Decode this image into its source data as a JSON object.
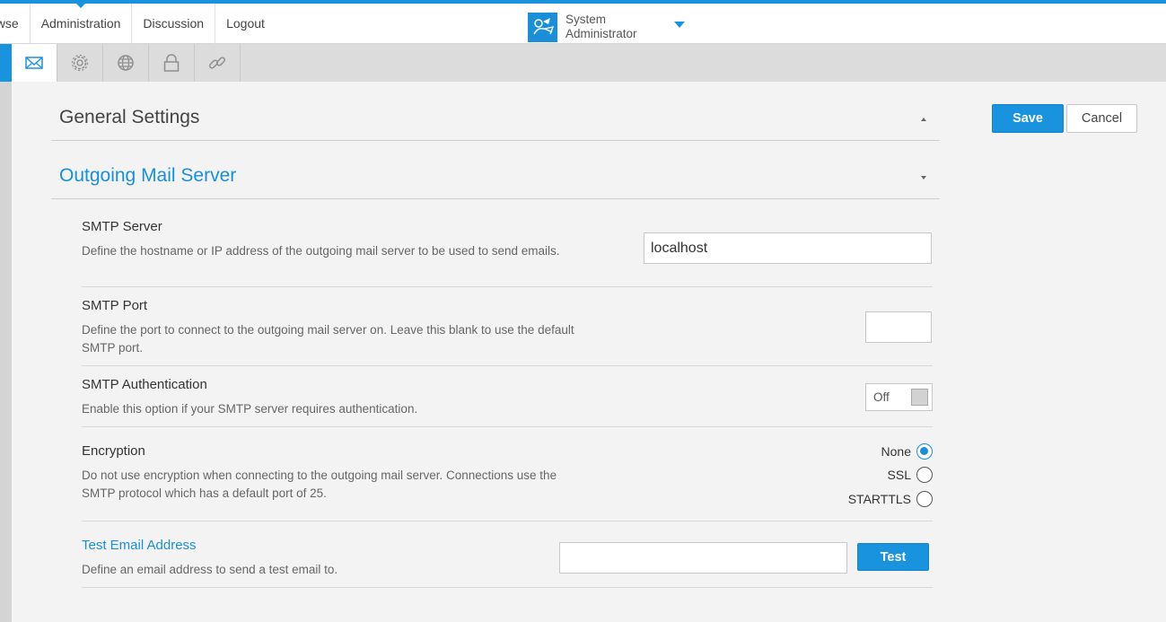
{
  "nav": {
    "items": [
      {
        "label": "owse"
      },
      {
        "label": "Administration"
      },
      {
        "label": "Discussion"
      },
      {
        "label": "Logout"
      }
    ]
  },
  "user": {
    "name_line1": "System",
    "name_line2": "Administrator"
  },
  "tabs": [
    {
      "icon": "envelope-icon"
    },
    {
      "icon": "gear-icon"
    },
    {
      "icon": "globe-icon"
    },
    {
      "icon": "lock-icon"
    },
    {
      "icon": "link-icon"
    }
  ],
  "sections": {
    "general": {
      "title": "General Settings"
    },
    "outgoing": {
      "title": "Outgoing Mail Server"
    }
  },
  "settings": {
    "smtp_server": {
      "label": "SMTP Server",
      "description": "Define the hostname or IP address of the outgoing mail server to be used to send emails.",
      "value": "localhost"
    },
    "smtp_port": {
      "label": "SMTP Port",
      "description": "Define the port to connect to the outgoing mail server on. Leave this blank to use the default SMTP port.",
      "value": ""
    },
    "smtp_auth": {
      "label": "SMTP Authentication",
      "description": "Enable this option if your SMTP server requires authentication.",
      "state": "Off"
    },
    "encryption": {
      "label": "Encryption",
      "description": "Do not use encryption when connecting to the outgoing mail server. Connections use the SMTP protocol which has a default port of 25.",
      "options": [
        {
          "label": "None",
          "checked": true
        },
        {
          "label": "SSL",
          "checked": false
        },
        {
          "label": "STARTTLS",
          "checked": false
        }
      ]
    },
    "test_email": {
      "label": "Test Email Address",
      "description": "Define an email address to send a test email to.",
      "value": "",
      "button": "Test"
    }
  },
  "actions": {
    "save": "Save",
    "cancel": "Cancel"
  },
  "colors": {
    "accent": "#1a93de"
  }
}
